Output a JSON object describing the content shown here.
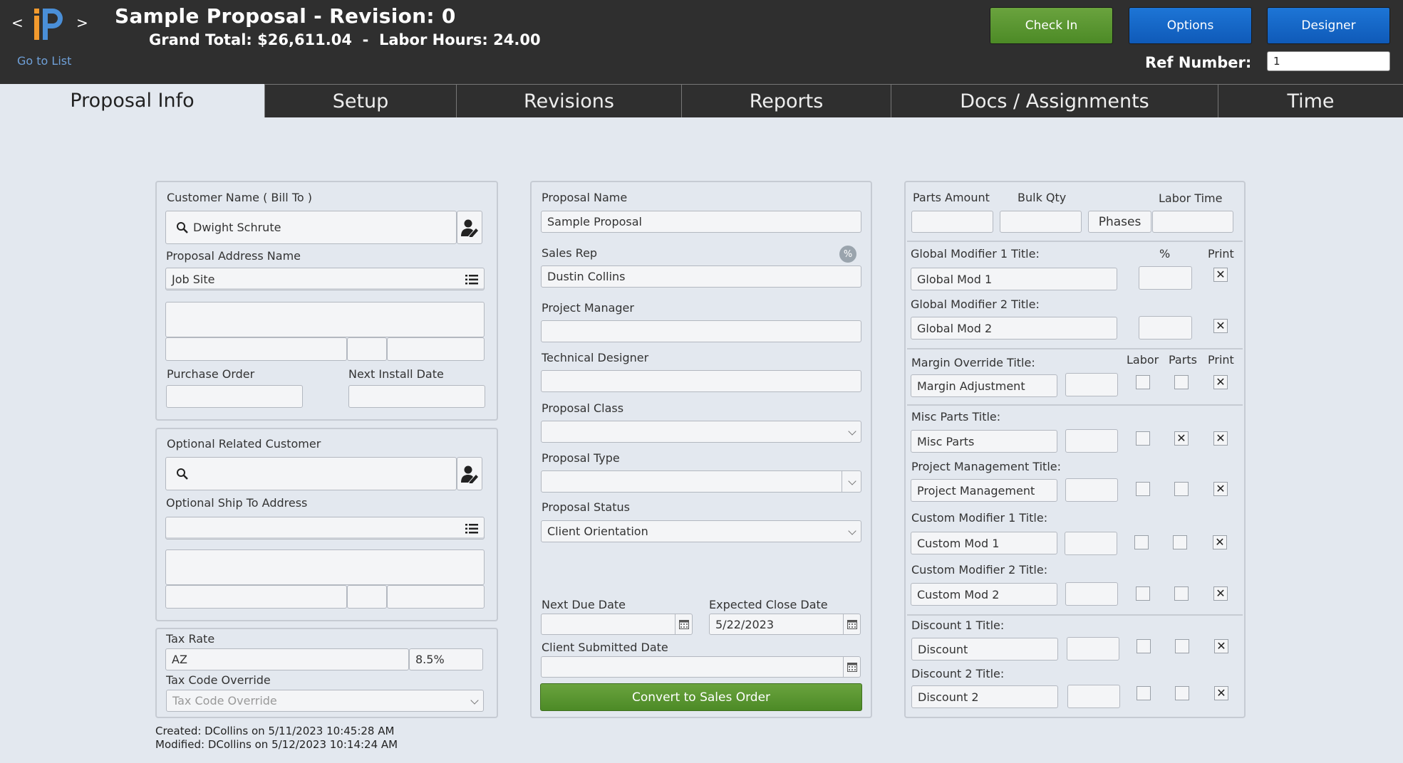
{
  "header": {
    "prev": "<",
    "next": ">",
    "go_to_list": "Go to List",
    "title": "Sample Proposal - Revision: 0",
    "totals": "Grand Total: $26,611.04  -  Labor Hours: 24.00",
    "buttons": {
      "check_in": "Check In",
      "options": "Options",
      "designer": "Designer"
    },
    "ref_label": "Ref Number:",
    "ref_value": "1",
    "colors": {
      "check_in": "#5c9a32",
      "options": "#1565c8",
      "designer": "#1565c8"
    }
  },
  "tabs": [
    "Proposal Info",
    "Setup",
    "Revisions",
    "Reports",
    "Docs / Assignments",
    "Time"
  ],
  "customer_panel": {
    "customer_label": "Customer Name ( Bill To )",
    "customer_value": "Dwight Schrute",
    "address_name_label": "Proposal Address Name",
    "address_name_value": "Job Site",
    "po_label": "Purchase Order",
    "po_value": "",
    "install_label": "Next Install Date",
    "install_value": ""
  },
  "related_panel": {
    "related_label": "Optional Related Customer",
    "related_value": "",
    "ship_label": "Optional Ship To Address",
    "ship_value": ""
  },
  "tax_panel": {
    "rate_label": "Tax Rate",
    "rate_code": "AZ",
    "rate_value": "8.5%",
    "override_label": "Tax Code Override",
    "override_placeholder": "Tax Code Override"
  },
  "audit": {
    "created": "Created: DCollins on 5/11/2023 10:45:28 AM",
    "modified": "Modified: DCollins on 5/12/2023 10:14:24 AM"
  },
  "proposal_panel": {
    "name_label": "Proposal Name",
    "name_value": "Sample Proposal",
    "sales_rep_label": "Sales Rep",
    "sales_rep_value": "Dustin Collins",
    "pm_label": "Project Manager",
    "pm_value": "",
    "td_label": "Technical Designer",
    "td_value": "",
    "class_label": "Proposal Class",
    "class_value": "",
    "type_label": "Proposal Type",
    "type_value": "",
    "status_label": "Proposal Status",
    "status_value": "Client Orientation",
    "next_due_label": "Next Due Date",
    "next_due_value": "",
    "close_label": "Expected Close Date",
    "close_value": "5/22/2023",
    "submitted_label": "Client Submitted Date",
    "submitted_value": "",
    "convert_button": "Convert to Sales Order",
    "pct_badge": "%"
  },
  "modifiers_panel": {
    "parts_amount_label": "Parts Amount",
    "bulk_qty_label": "Bulk Qty",
    "phases_button": "Phases",
    "labor_time_label": "Labor Time",
    "pct_header": "%",
    "print_header": "Print",
    "labor_header": "Labor",
    "parts_header": "Parts",
    "global1_label": "Global Modifier 1 Title:",
    "global1_value": "Global Mod 1",
    "global2_label": "Global Modifier 2 Title:",
    "global2_value": "Global Mod 2",
    "margin_label": "Margin Override Title:",
    "margin_value": "Margin Adjustment",
    "misc_label": "Misc Parts Title:",
    "misc_value": "Misc Parts",
    "pm_label": "Project Management Title:",
    "pm_value": "Project Management",
    "custom1_label": "Custom Modifier 1 Title:",
    "custom1_value": "Custom Mod 1",
    "custom2_label": "Custom Modifier 2 Title:",
    "custom2_value": "Custom Mod 2",
    "discount1_label": "Discount 1 Title:",
    "discount1_value": "Discount",
    "discount2_label": "Discount 2 Title:",
    "discount2_value": "Discount 2",
    "checks": {
      "global1": {
        "print": true
      },
      "global2": {
        "print": true
      },
      "margin": {
        "labor": false,
        "parts": false,
        "print": true
      },
      "misc": {
        "labor": false,
        "parts": true,
        "print": true
      },
      "pm": {
        "labor": false,
        "parts": false,
        "print": true
      },
      "custom1": {
        "labor": false,
        "parts": false,
        "print": true
      },
      "custom2": {
        "labor": false,
        "parts": false,
        "print": true
      },
      "discount1": {
        "labor": false,
        "parts": false,
        "print": true
      },
      "discount2": {
        "labor": false,
        "parts": false,
        "print": true
      }
    }
  },
  "icons": [
    "search-icon",
    "edit-customer-icon",
    "list-icon",
    "chevron-down-icon",
    "calendar-icon",
    "logo-icon"
  ]
}
